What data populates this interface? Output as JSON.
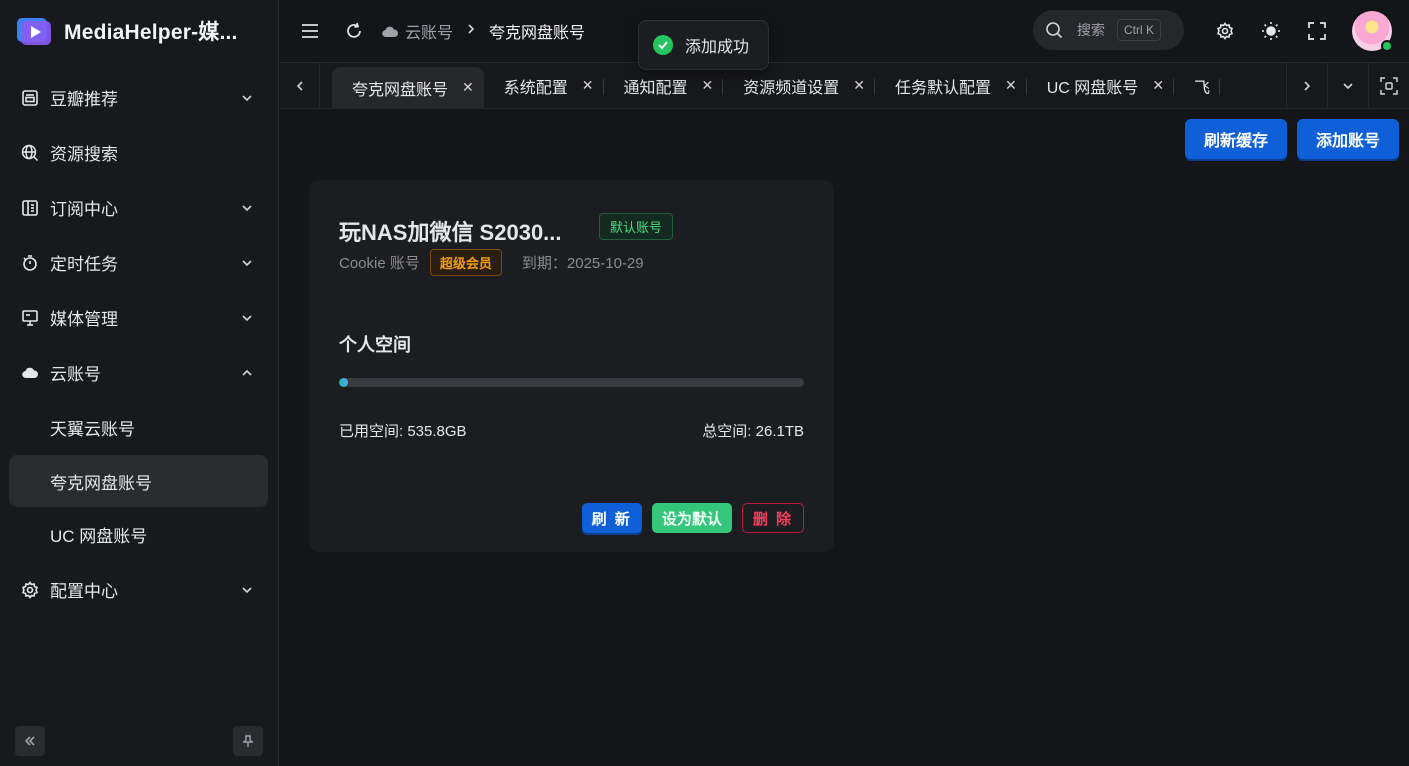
{
  "app": {
    "title": "MediaHelper-媒..."
  },
  "sidebar": {
    "items": [
      {
        "label": "豆瓣推荐",
        "icon": "douban-icon",
        "expandable": true
      },
      {
        "label": "资源搜索",
        "icon": "globe-search-icon",
        "expandable": false
      },
      {
        "label": "订阅中心",
        "icon": "subscription-icon",
        "expandable": true
      },
      {
        "label": "定时任务",
        "icon": "timer-icon",
        "expandable": true
      },
      {
        "label": "媒体管理",
        "icon": "media-monitor-icon",
        "expandable": true
      },
      {
        "label": "云账号",
        "icon": "cloud-icon",
        "expandable": true,
        "expanded": true
      },
      {
        "label": "天翼云账号",
        "sub": true
      },
      {
        "label": "夸克网盘账号",
        "sub": true,
        "active": true
      },
      {
        "label": "UC 网盘账号",
        "sub": true
      },
      {
        "label": "配置中心",
        "icon": "gear-icon",
        "expandable": true
      }
    ]
  },
  "header": {
    "breadcrumb": {
      "parent": "云账号",
      "current": "夸克网盘账号"
    },
    "search": {
      "placeholder": "搜索",
      "shortcut": "Ctrl K"
    }
  },
  "toast": {
    "text": "添加成功"
  },
  "tabs": [
    {
      "label": "夸克网盘账号",
      "active": true
    },
    {
      "label": "系统配置"
    },
    {
      "label": "通知配置"
    },
    {
      "label": "资源频道设置"
    },
    {
      "label": "任务默认配置"
    },
    {
      "label": "UC 网盘账号"
    },
    {
      "label": "飞"
    }
  ],
  "actions": {
    "refresh_cache": "刷新缓存",
    "add_account": "添加账号"
  },
  "account": {
    "name": "玩NAS加微信 S2030...",
    "default_tag": "默认账号",
    "type": "Cookie 账号",
    "membership": "超级会员",
    "expire": "到期：2025-10-29",
    "section": "个人空间",
    "used_percent": 2,
    "used": "已用空间: 535.8GB",
    "total": "总空间: 26.1TB",
    "btn_refresh": "刷 新",
    "btn_set_default": "设为默认",
    "btn_delete": "删 除"
  },
  "colors": {
    "accent": "#0e5fd8",
    "success": "#22c55e",
    "danger": "#f43f5e",
    "warning": "#f59e0b"
  }
}
